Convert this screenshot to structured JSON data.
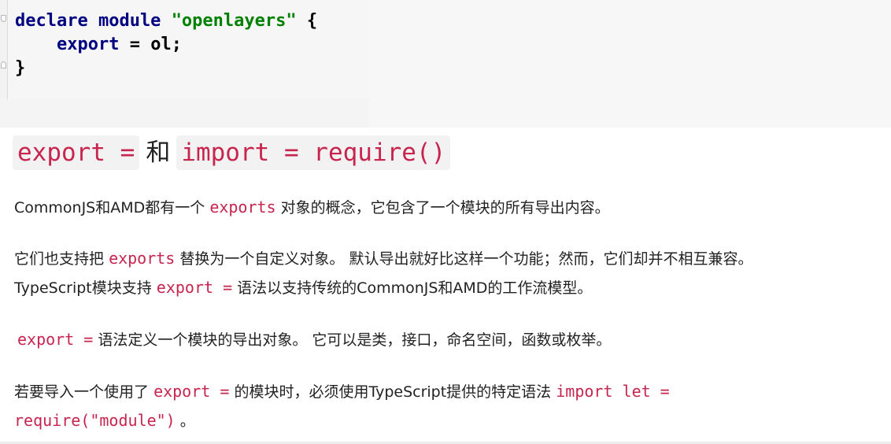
{
  "code_block": {
    "line1": {
      "keyword": "declare module",
      "space": " ",
      "string": "\"openlayers\"",
      "rest": " {"
    },
    "line2": {
      "indent": "    ",
      "keyword": "export",
      "rest": " = ol;"
    },
    "line3": {
      "text": "}"
    }
  },
  "heading": {
    "code1": "export =",
    "conj": "和",
    "code2": "import = require()"
  },
  "para1": {
    "t1": "CommonJS和AMD都有一个",
    "c1": "exports",
    "t2": "对象的概念，它包含了一个模块的所有导出内容。"
  },
  "para2": {
    "line1": {
      "t1": "它们也支持把",
      "c1": "exports",
      "t2": "替换为一个自定义对象。 默认导出就好比这样一个功能；然而，它们却并不相互兼容。"
    },
    "line2": {
      "t1": "TypeScript模块支持 ",
      "c1": "export =",
      "t2": "语法以支持传统的CommonJS和AMD的工作流模型。"
    }
  },
  "para3": {
    "c1": "export =",
    "t1": "语法定义一个模块的导出对象。 它可以是类，接口，命名空间，函数或枚举。"
  },
  "para4": {
    "line1": {
      "t1": "若要导入一个使用了",
      "c1": "export =",
      "t2": "的模块时，必须使用TypeScript提供的特定语法",
      "c2": "import let ="
    },
    "line2": {
      "c1": "require(\"module\")",
      "t1": "。"
    }
  }
}
